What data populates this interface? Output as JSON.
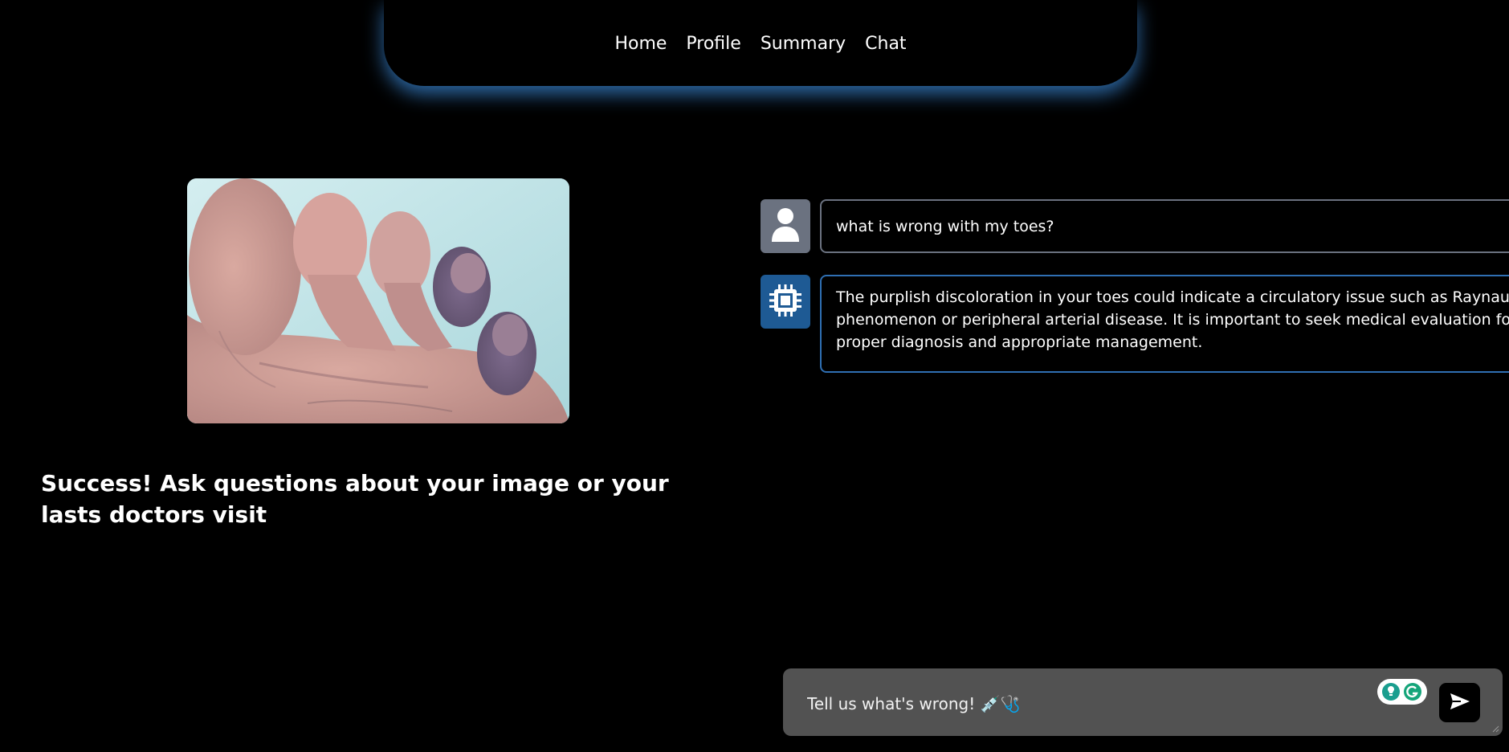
{
  "nav": {
    "items": [
      {
        "label": "Home"
      },
      {
        "label": "Profile"
      },
      {
        "label": "Summary"
      },
      {
        "label": "Chat"
      }
    ]
  },
  "upload": {
    "image_icon": "uploaded-photo",
    "status_text": "Success! Ask questions about your image or your lasts doctors visit"
  },
  "chat": {
    "messages": [
      {
        "role": "user",
        "avatar_icon": "person-icon",
        "text": "what is wrong with my toes?"
      },
      {
        "role": "assistant",
        "avatar_icon": "chip-icon",
        "text": "The purplish discoloration in your toes could indicate a circulatory issue such as Raynaud's phenomenon or peripheral arterial disease. It is important to seek medical evaluation for a proper diagnosis and appropriate management."
      }
    ],
    "input": {
      "placeholder": "Tell us what's wrong! 💉🩺",
      "value": ""
    },
    "send_icon": "paper-plane-icon"
  },
  "colors": {
    "background": "#000000",
    "nav_glow": "#3c8cdc",
    "user_avatar": "#6b7280",
    "bot_avatar": "#1e5a94",
    "bot_border": "#2f6fb3",
    "input_bg": "#525252"
  }
}
